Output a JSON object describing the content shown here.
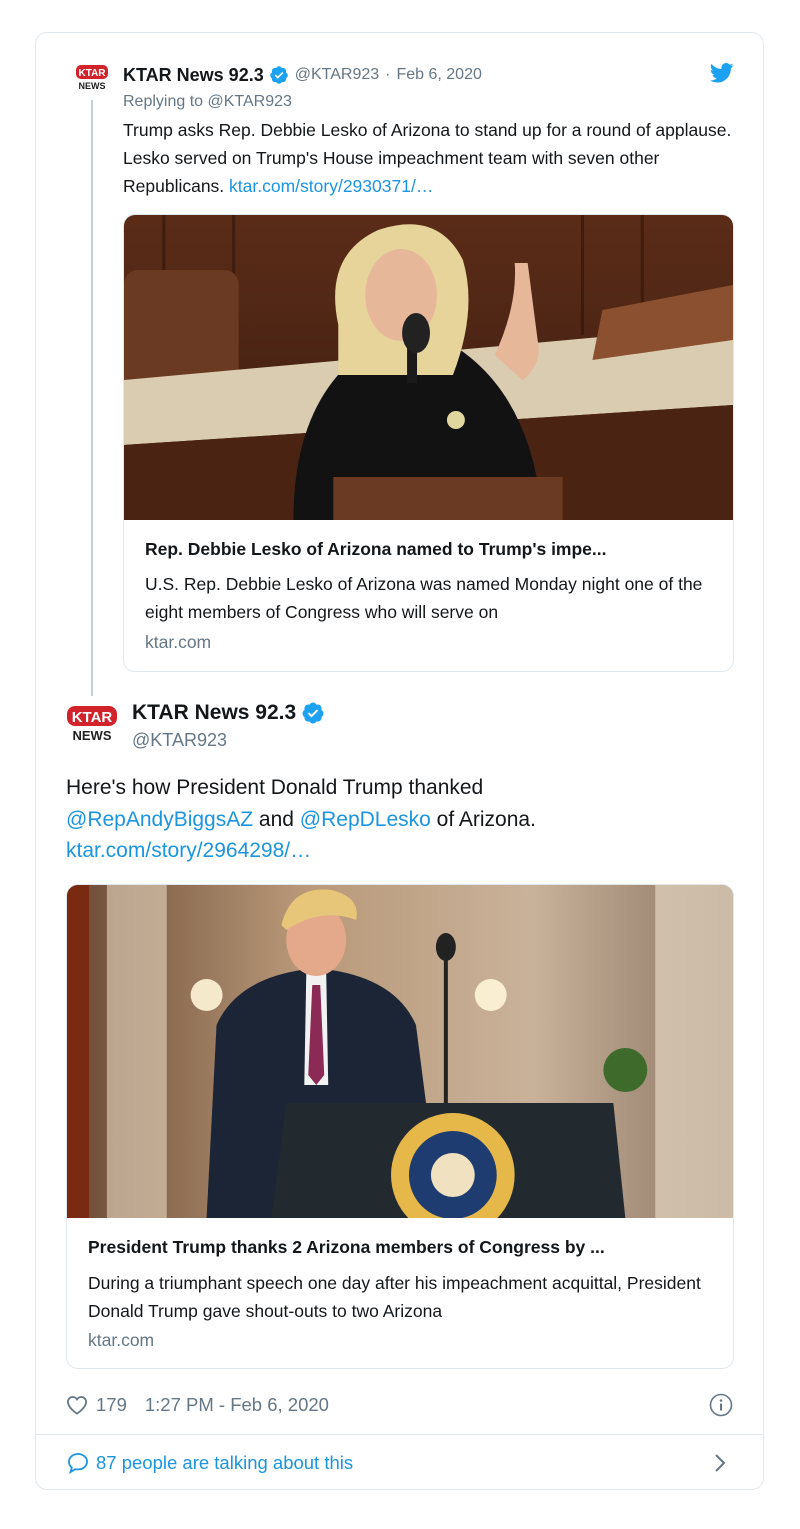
{
  "reply_tweet": {
    "avatar_text_top": "KTAR",
    "avatar_text_bottom": "NEWS",
    "name": "KTAR News 92.3",
    "handle": "@KTAR923",
    "separator": "·",
    "date": "Feb 6, 2020",
    "replying_to": "Replying to @KTAR923",
    "text": "Trump asks Rep. Debbie Lesko of Arizona to stand up for a round of applause. Lesko served on Trump's House impeachment team with seven other Republicans.",
    "link": "ktar.com/story/2930371/…",
    "card": {
      "title": "Rep. Debbie Lesko of Arizona named to Trump's impe...",
      "description": "U.S. Rep. Debbie Lesko of Arizona was named Monday night one of the eight members of Congress who will serve on",
      "domain": "ktar.com"
    }
  },
  "main_tweet": {
    "avatar_text_top": "KTAR",
    "avatar_text_bottom": "NEWS",
    "name": "KTAR News 92.3",
    "handle": "@KTAR923",
    "text_part1": "Here's how President Donald Trump thanked",
    "mention1": "@RepAndyBiggsAZ",
    "text_part2": " and ",
    "mention2": "@RepDLesko",
    "text_part3": " of Arizona.",
    "link": "ktar.com/story/2964298/…",
    "card": {
      "title": "President Trump thanks 2 Arizona members of Congress by ...",
      "description": "During a triumphant speech one day after his impeachment acquittal, President Donald Trump gave shout-outs to two Arizona",
      "domain": "ktar.com"
    },
    "likes": "179",
    "timestamp": "1:27 PM - Feb 6, 2020",
    "talking": "87 people are talking about this"
  },
  "colors": {
    "link": "#1b95e0",
    "verified": "#1da1f2",
    "muted": "#657786",
    "border": "#e1e8ed",
    "ktar_red": "#d2232a"
  }
}
